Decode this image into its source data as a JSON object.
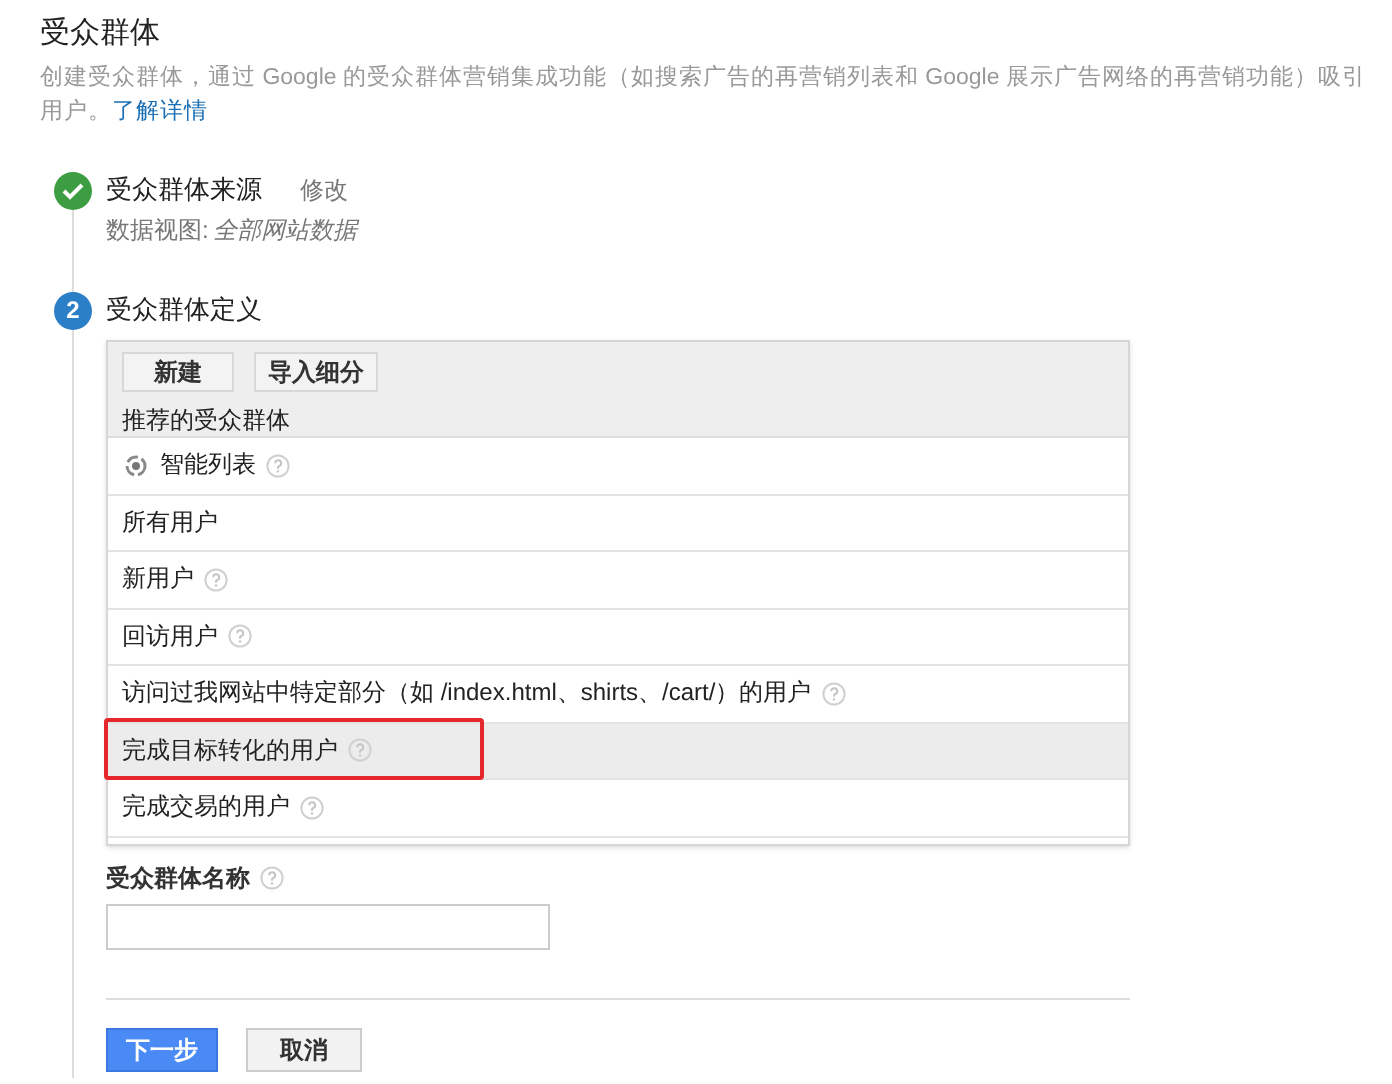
{
  "title": "受众群体",
  "description": {
    "text": "创建受众群体，通过 Google 的受众群体营销集成功能（如搜索广告的再营销列表和 Google 展示广告网络的再营销功能）吸引用户。",
    "link": "了解详情"
  },
  "steps": [
    {
      "completed": true,
      "title": "受众群体来源",
      "action": "修改",
      "detail_label": "数据视图:",
      "detail_value": "全部网站数据"
    },
    {
      "number": "2",
      "completed": false,
      "title": "受众群体定义"
    }
  ],
  "toolbar": [
    "新建",
    "导入细分"
  ],
  "list_header": "推荐的受众群体",
  "audiences": [
    {
      "kind": "smart",
      "label": "智能列表",
      "help": true,
      "selected": false,
      "annotated": false
    },
    {
      "kind": "plain",
      "label": "所有用户",
      "help": false,
      "selected": false,
      "annotated": false
    },
    {
      "kind": "plain",
      "label": "新用户",
      "help": true,
      "selected": false,
      "annotated": false
    },
    {
      "kind": "plain",
      "label": "回访用户",
      "help": true,
      "selected": false,
      "annotated": false
    },
    {
      "kind": "plain",
      "label": "访问过我网站中特定部分（如 /index.html、shirts、/cart/）的用户",
      "help": true,
      "selected": false,
      "annotated": false
    },
    {
      "kind": "plain",
      "label": "完成目标转化的用户",
      "help": true,
      "selected": true,
      "annotated": true
    },
    {
      "kind": "plain",
      "label": "完成交易的用户",
      "help": true,
      "selected": false,
      "annotated": false
    }
  ],
  "name_field": {
    "label": "受众群体名称",
    "help": true
  },
  "buttons": [
    {
      "label": "下一步",
      "kind": "primary"
    },
    {
      "label": "取消",
      "kind": "secondary"
    }
  ]
}
